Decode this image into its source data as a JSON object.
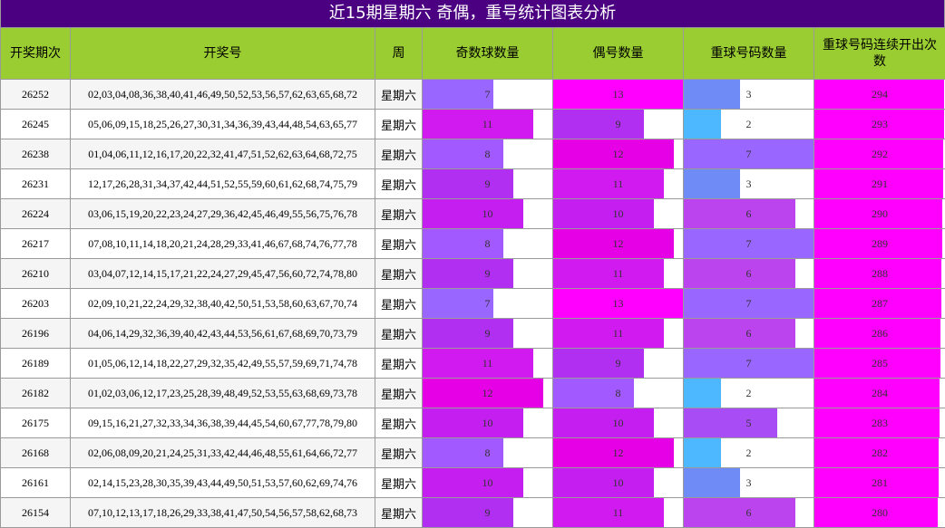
{
  "title": "近15期星期六 奇偶，重号统计图表分析",
  "headers": {
    "issue": "开奖期次",
    "numbers": "开奖号",
    "weekday": "周",
    "odd": "奇数球数量",
    "even": "偶号数量",
    "repeat": "重球号码数量",
    "streak": "重球号码连续开出次数"
  },
  "colors": {
    "title_bg": "#4b0082",
    "header_bg": "#9acd32",
    "row_alt_bg": "#f5f5f5",
    "level_2": "#4db8ff",
    "level_3": "#6f8cf6",
    "level_5": "#a84df5",
    "level_6": "#bb44ef",
    "level_7": "#9966ff",
    "level_8": "#a259ff",
    "level_9": "#b02ff0",
    "level_10": "#c41ff0",
    "level_11": "#d11af0",
    "level_12": "#e600e6",
    "level_13": "#ff00ff",
    "streak_bar": "#ff00ff"
  },
  "chart_data": {
    "type": "table",
    "scale_max": {
      "odd": 13,
      "even": 13,
      "repeat": 7,
      "streak": 294
    },
    "rows": [
      {
        "issue": "26252",
        "numbers": "02,03,04,08,36,38,40,41,46,49,50,52,53,56,57,62,63,65,68,72",
        "weekday": "星期六",
        "odd": 7,
        "even": 13,
        "repeat": 3,
        "streak": 294
      },
      {
        "issue": "26245",
        "numbers": "05,06,09,15,18,25,26,27,30,31,34,36,39,43,44,48,54,63,65,77",
        "weekday": "星期六",
        "odd": 11,
        "even": 9,
        "repeat": 2,
        "streak": 293
      },
      {
        "issue": "26238",
        "numbers": "01,04,06,11,12,16,17,20,22,32,41,47,51,52,62,63,64,68,72,75",
        "weekday": "星期六",
        "odd": 8,
        "even": 12,
        "repeat": 7,
        "streak": 292
      },
      {
        "issue": "26231",
        "numbers": "12,17,26,28,31,34,37,42,44,51,52,55,59,60,61,62,68,74,75,79",
        "weekday": "星期六",
        "odd": 9,
        "even": 11,
        "repeat": 3,
        "streak": 291
      },
      {
        "issue": "26224",
        "numbers": "03,06,15,19,20,22,23,24,27,29,36,42,45,46,49,55,56,75,76,78",
        "weekday": "星期六",
        "odd": 10,
        "even": 10,
        "repeat": 6,
        "streak": 290
      },
      {
        "issue": "26217",
        "numbers": "07,08,10,11,14,18,20,21,24,28,29,33,41,46,67,68,74,76,77,78",
        "weekday": "星期六",
        "odd": 8,
        "even": 12,
        "repeat": 7,
        "streak": 289
      },
      {
        "issue": "26210",
        "numbers": "03,04,07,12,14,15,17,21,22,24,27,29,45,47,56,60,72,74,78,80",
        "weekday": "星期六",
        "odd": 9,
        "even": 11,
        "repeat": 6,
        "streak": 288
      },
      {
        "issue": "26203",
        "numbers": "02,09,10,21,22,24,29,32,38,40,42,50,51,53,58,60,63,67,70,74",
        "weekday": "星期六",
        "odd": 7,
        "even": 13,
        "repeat": 7,
        "streak": 287
      },
      {
        "issue": "26196",
        "numbers": "04,06,14,29,32,36,39,40,42,43,44,53,56,61,67,68,69,70,73,79",
        "weekday": "星期六",
        "odd": 9,
        "even": 11,
        "repeat": 6,
        "streak": 286
      },
      {
        "issue": "26189",
        "numbers": "01,05,06,12,14,18,22,27,29,32,35,42,49,55,57,59,69,71,74,78",
        "weekday": "星期六",
        "odd": 11,
        "even": 9,
        "repeat": 7,
        "streak": 285
      },
      {
        "issue": "26182",
        "numbers": "01,02,03,06,12,17,23,25,28,39,48,49,52,53,55,63,68,69,73,78",
        "weekday": "星期六",
        "odd": 12,
        "even": 8,
        "repeat": 2,
        "streak": 284
      },
      {
        "issue": "26175",
        "numbers": "09,15,16,21,27,32,33,34,36,38,39,44,45,54,60,67,77,78,79,80",
        "weekday": "星期六",
        "odd": 10,
        "even": 10,
        "repeat": 5,
        "streak": 283
      },
      {
        "issue": "26168",
        "numbers": "02,06,08,09,20,21,24,25,31,33,42,44,46,48,55,61,64,66,72,77",
        "weekday": "星期六",
        "odd": 8,
        "even": 12,
        "repeat": 2,
        "streak": 282
      },
      {
        "issue": "26161",
        "numbers": "02,14,15,23,28,30,35,39,43,44,49,50,51,53,57,60,62,69,74,76",
        "weekday": "星期六",
        "odd": 10,
        "even": 10,
        "repeat": 3,
        "streak": 281
      },
      {
        "issue": "26154",
        "numbers": "07,10,12,13,17,18,26,29,33,38,41,47,50,54,56,57,58,62,68,73",
        "weekday": "星期六",
        "odd": 9,
        "even": 11,
        "repeat": 6,
        "streak": 280
      }
    ]
  }
}
